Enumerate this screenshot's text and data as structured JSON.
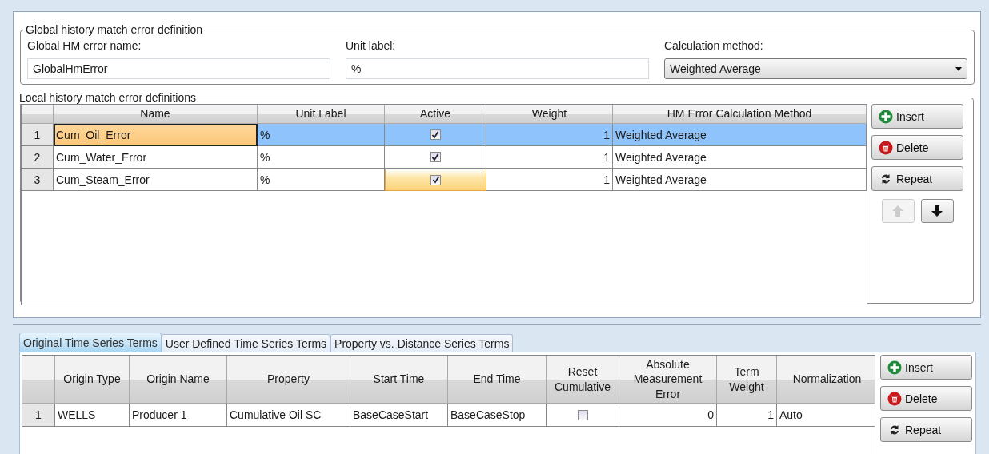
{
  "global_definition": {
    "legend": "Global history match error definition",
    "name_label": "Global HM error name:",
    "name_value": "GlobalHmError",
    "unit_label": "Unit label:",
    "unit_value": "%",
    "method_label": "Calculation method:",
    "method_value": "Weighted Average"
  },
  "local_definitions": {
    "legend": "Local history match error definitions",
    "columns": [
      "Name",
      "Unit Label",
      "Active",
      "Weight",
      "HM Error Calculation Method"
    ],
    "rows": [
      {
        "index": "1",
        "name": "Cum_Oil_Error",
        "unit": "%",
        "active": true,
        "weight": "1",
        "method": "Weighted Average",
        "selected": true,
        "name_focused": true,
        "active_focused": false
      },
      {
        "index": "2",
        "name": "Cum_Water_Error",
        "unit": "%",
        "active": true,
        "weight": "1",
        "method": "Weighted Average",
        "selected": false,
        "name_focused": false,
        "active_focused": false
      },
      {
        "index": "3",
        "name": "Cum_Steam_Error",
        "unit": "%",
        "active": true,
        "weight": "1",
        "method": "Weighted Average",
        "selected": false,
        "name_focused": false,
        "active_focused": true
      }
    ],
    "buttons": [
      {
        "kind": "insert",
        "label": "Insert"
      },
      {
        "kind": "delete",
        "label": "Delete"
      },
      {
        "kind": "repeat",
        "label": "Repeat"
      }
    ],
    "move_buttons": [
      {
        "kind": "up",
        "disabled": true
      },
      {
        "kind": "down",
        "disabled": false
      }
    ]
  },
  "terms": {
    "tabs": [
      {
        "label": "Original Time Series Terms",
        "selected": true
      },
      {
        "label": "User Defined Time Series Terms",
        "selected": false
      },
      {
        "label": "Property vs. Distance Series Terms",
        "selected": false
      }
    ],
    "columns": [
      "Origin Type",
      "Origin Name",
      "Property",
      "Start Time",
      "End Time",
      "Reset Cumulative",
      "Absolute Measurement Error",
      "Term Weight",
      "Normalization"
    ],
    "rows": [
      {
        "index": "1",
        "origin_type": "WELLS",
        "origin_name": "Producer 1",
        "property": "Cumulative Oil SC",
        "start_time": "BaseCaseStart",
        "end_time": "BaseCaseStop",
        "reset_cumulative": false,
        "absolute_error": "0",
        "term_weight": "1",
        "normalization": "Auto"
      }
    ],
    "buttons": [
      {
        "kind": "insert",
        "label": "Insert"
      },
      {
        "kind": "delete",
        "label": "Delete"
      },
      {
        "kind": "repeat",
        "label": "Repeat"
      }
    ]
  }
}
